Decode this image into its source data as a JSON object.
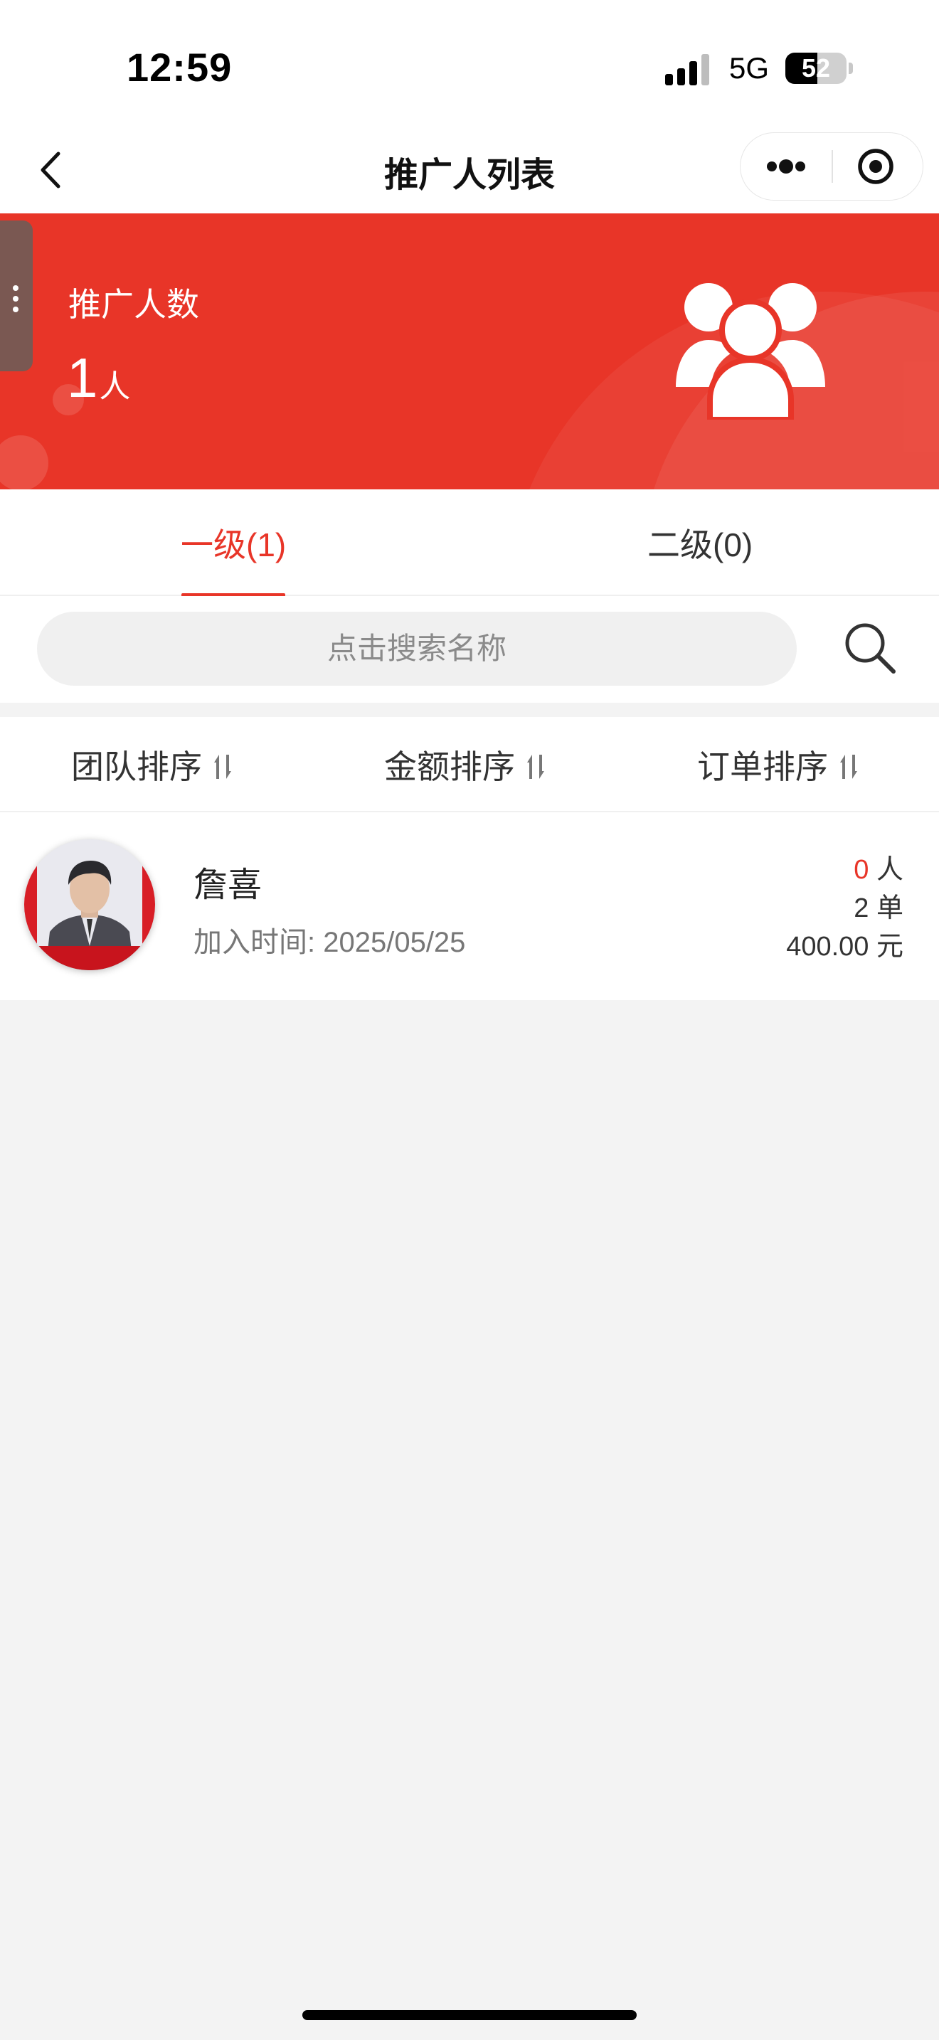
{
  "status_bar": {
    "time": "12:59",
    "network": "5G",
    "battery": "52",
    "battery_level_percent": 52
  },
  "nav": {
    "title": "推广人列表",
    "back_icon": "chevron-left-icon",
    "more_icon": "more-dots-icon",
    "close_icon": "target-close-icon"
  },
  "banner": {
    "label": "推广人数",
    "count": "1",
    "unit": "人",
    "icon": "users-group-icon",
    "color": "#e83528"
  },
  "tabs": [
    {
      "label": "一级(1)",
      "active": true
    },
    {
      "label": "二级(0)",
      "active": false
    }
  ],
  "search": {
    "placeholder": "点击搜索名称",
    "icon": "search-icon"
  },
  "sort": [
    {
      "label": "团队排序",
      "icon": "sort-icon"
    },
    {
      "label": "金额排序",
      "icon": "sort-icon"
    },
    {
      "label": "订单排序",
      "icon": "sort-icon"
    }
  ],
  "members": [
    {
      "name": "詹喜",
      "join_label": "加入时间: 2025/05/25",
      "people_count": "0",
      "people_unit": "人",
      "orders": "2 单",
      "amount": "400.00 元"
    }
  ],
  "colors": {
    "accent": "#e83528",
    "background": "#f3f3f3"
  }
}
